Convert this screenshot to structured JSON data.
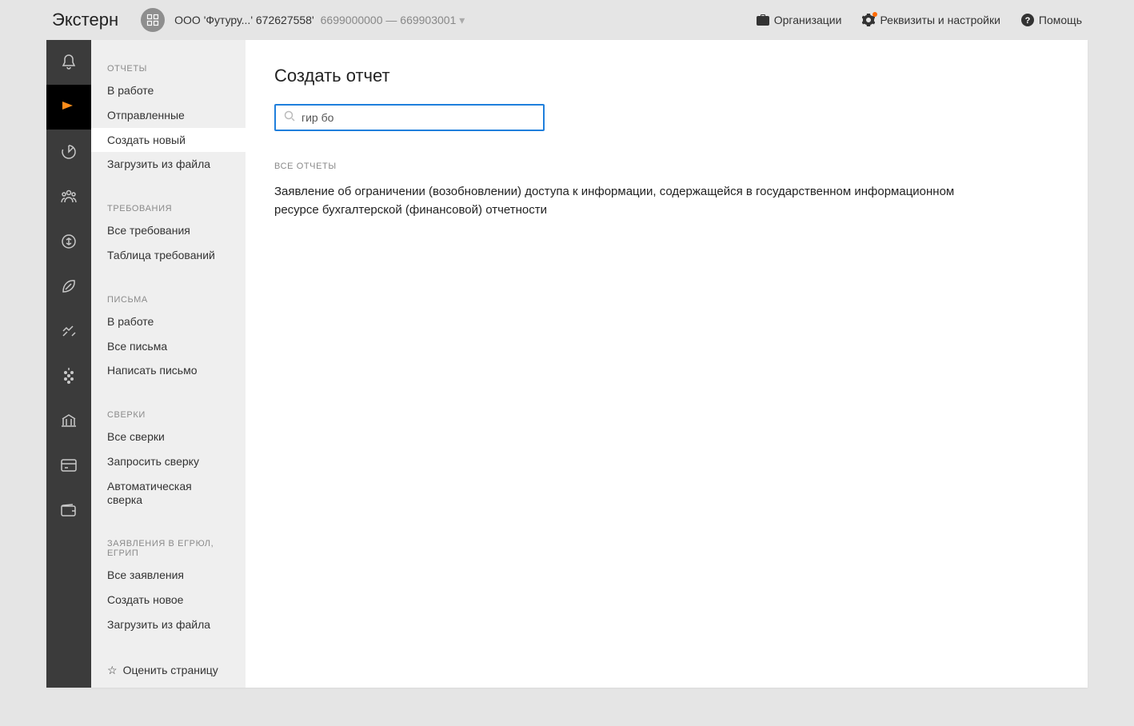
{
  "header": {
    "logo": "Экстерн",
    "org_name": "ООО 'Футуру...' 672627558'",
    "org_codes": "6699000000 — 669903001",
    "links": {
      "organizations": "Организации",
      "settings": "Реквизиты и настройки",
      "help": "Помощь"
    }
  },
  "sidebar": {
    "sections": [
      {
        "title": "ОТЧЕТЫ",
        "items": [
          "В работе",
          "Отправленные",
          "Создать новый",
          "Загрузить из файла"
        ],
        "active_index": 2
      },
      {
        "title": "ТРЕБОВАНИЯ",
        "items": [
          "Все требования",
          "Таблица требований"
        ]
      },
      {
        "title": "ПИСЬМА",
        "items": [
          "В работе",
          "Все письма",
          "Написать письмо"
        ]
      },
      {
        "title": "СВЕРКИ",
        "items": [
          "Все сверки",
          "Запросить сверку",
          "Автоматическая сверка"
        ]
      },
      {
        "title": "ЗАЯВЛЕНИЯ В ЕГРЮЛ, ЕГРИП",
        "items": [
          "Все заявления",
          "Создать новое",
          "Загрузить из файла"
        ]
      }
    ],
    "rate": "Оценить страницу"
  },
  "main": {
    "title": "Создать отчет",
    "search_value": "гир бо",
    "results_label": "ВСЕ ОТЧЕТЫ",
    "result_text": "Заявление об ограничении (возобновлении) доступа к информации, содержащейся в государственном информационном ресурсе бухгалтерской (финансовой) отчетности"
  }
}
